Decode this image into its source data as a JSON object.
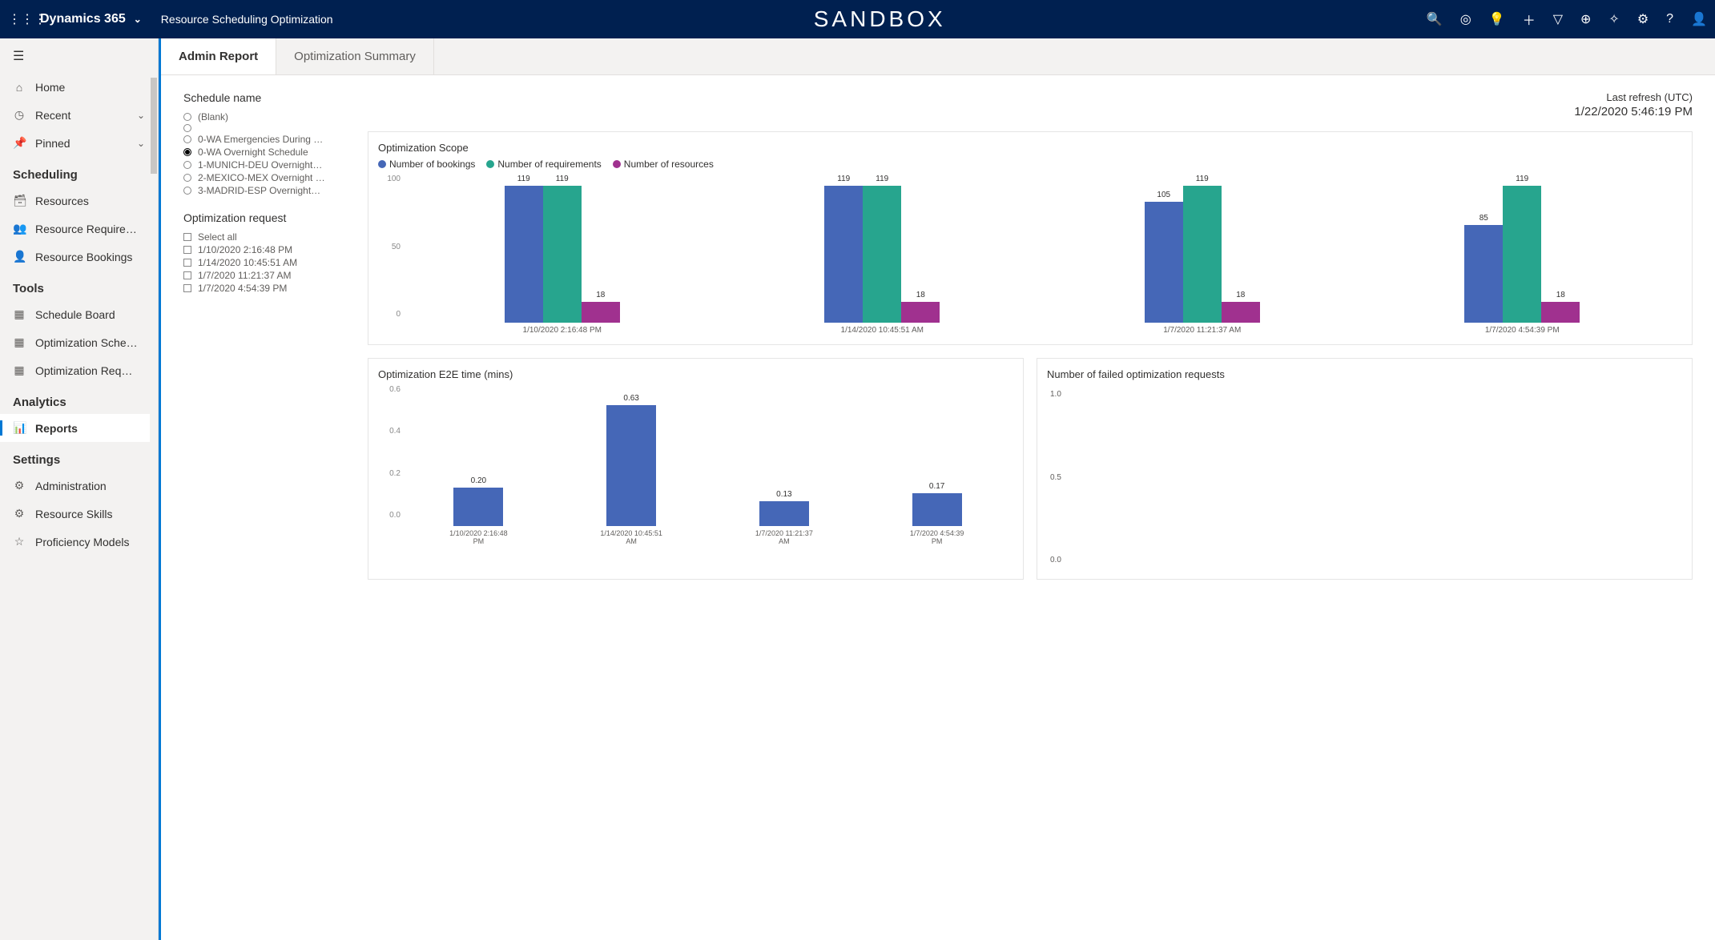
{
  "topbar": {
    "brand": "Dynamics 365",
    "subtitle": "Resource Scheduling Optimization",
    "env": "SANDBOX"
  },
  "sidebar": {
    "top": [
      {
        "icon": "⌂",
        "label": "Home"
      },
      {
        "icon": "◷",
        "label": "Recent",
        "chev": true
      },
      {
        "icon": "📌",
        "label": "Pinned",
        "chev": true
      }
    ],
    "groups": [
      {
        "heading": "Scheduling",
        "items": [
          {
            "icon": "🗃",
            "label": "Resources"
          },
          {
            "icon": "👥",
            "label": "Resource Require…"
          },
          {
            "icon": "👤",
            "label": "Resource Bookings"
          }
        ]
      },
      {
        "heading": "Tools",
        "items": [
          {
            "icon": "▦",
            "label": "Schedule Board"
          },
          {
            "icon": "▦",
            "label": "Optimization Sche…"
          },
          {
            "icon": "▦",
            "label": "Optimization Req…"
          }
        ]
      },
      {
        "heading": "Analytics",
        "items": [
          {
            "icon": "📊",
            "label": "Reports",
            "selected": true
          }
        ]
      },
      {
        "heading": "Settings",
        "items": [
          {
            "icon": "⚙",
            "label": "Administration"
          },
          {
            "icon": "⚙",
            "label": "Resource Skills"
          },
          {
            "icon": "☆",
            "label": "Proficiency Models"
          }
        ]
      }
    ]
  },
  "tabs": [
    {
      "label": "Admin Report",
      "active": true
    },
    {
      "label": "Optimization Summary",
      "active": false
    }
  ],
  "filters": {
    "schedule_title": "Schedule name",
    "schedules": [
      {
        "label": "(Blank)",
        "selected": false
      },
      {
        "label": "",
        "selected": false
      },
      {
        "label": "0-WA Emergencies During …",
        "selected": false
      },
      {
        "label": "0-WA Overnight Schedule",
        "selected": true
      },
      {
        "label": "1-MUNICH-DEU Overnight…",
        "selected": false
      },
      {
        "label": "2-MEXICO-MEX Overnight …",
        "selected": false
      },
      {
        "label": "3-MADRID-ESP Overnight…",
        "selected": false
      }
    ],
    "request_title": "Optimization request",
    "select_all": "Select all",
    "requests": [
      "1/10/2020 2:16:48 PM",
      "1/14/2020 10:45:51 AM",
      "1/7/2020 11:21:37 AM",
      "1/7/2020 4:54:39 PM"
    ]
  },
  "refresh": {
    "label": "Last refresh (UTC)",
    "ts": "1/22/2020 5:46:19 PM"
  },
  "chart_data": [
    {
      "type": "bar",
      "title": "Optimization Scope",
      "legend": [
        "Number of bookings",
        "Number of requirements",
        "Number of resources"
      ],
      "colors": [
        "#4567b7",
        "#27a58e",
        "#a0318f"
      ],
      "categories": [
        "1/10/2020 2:16:48 PM",
        "1/14/2020 10:45:51 AM",
        "1/7/2020 11:21:37 AM",
        "1/7/2020 4:54:39 PM"
      ],
      "series": [
        {
          "name": "Number of bookings",
          "values": [
            119,
            119,
            105,
            85
          ]
        },
        {
          "name": "Number of requirements",
          "values": [
            119,
            119,
            119,
            119
          ]
        },
        {
          "name": "Number of resources",
          "values": [
            18,
            18,
            18,
            18
          ]
        }
      ],
      "yticks": [
        0,
        50,
        100
      ],
      "ymax": 125
    },
    {
      "type": "bar",
      "title": "Optimization E2E time (mins)",
      "categories": [
        "1/10/2020 2:16:48 PM",
        "1/14/2020 10:45:51 AM",
        "1/7/2020 11:21:37 AM",
        "1/7/2020 4:54:39 PM"
      ],
      "values": [
        0.2,
        0.63,
        0.13,
        0.17
      ],
      "value_labels": [
        "0.20",
        "0.63",
        "0.13",
        "0.17"
      ],
      "color": "#4567b7",
      "yticks": [
        "0.0",
        "0.2",
        "0.4",
        "0.6"
      ],
      "ymax": 0.7
    },
    {
      "type": "bar",
      "title": "Number of failed optimization requests",
      "categories": [],
      "values": [],
      "yticks": [
        "0.0",
        "0.5",
        "1.0"
      ]
    }
  ]
}
